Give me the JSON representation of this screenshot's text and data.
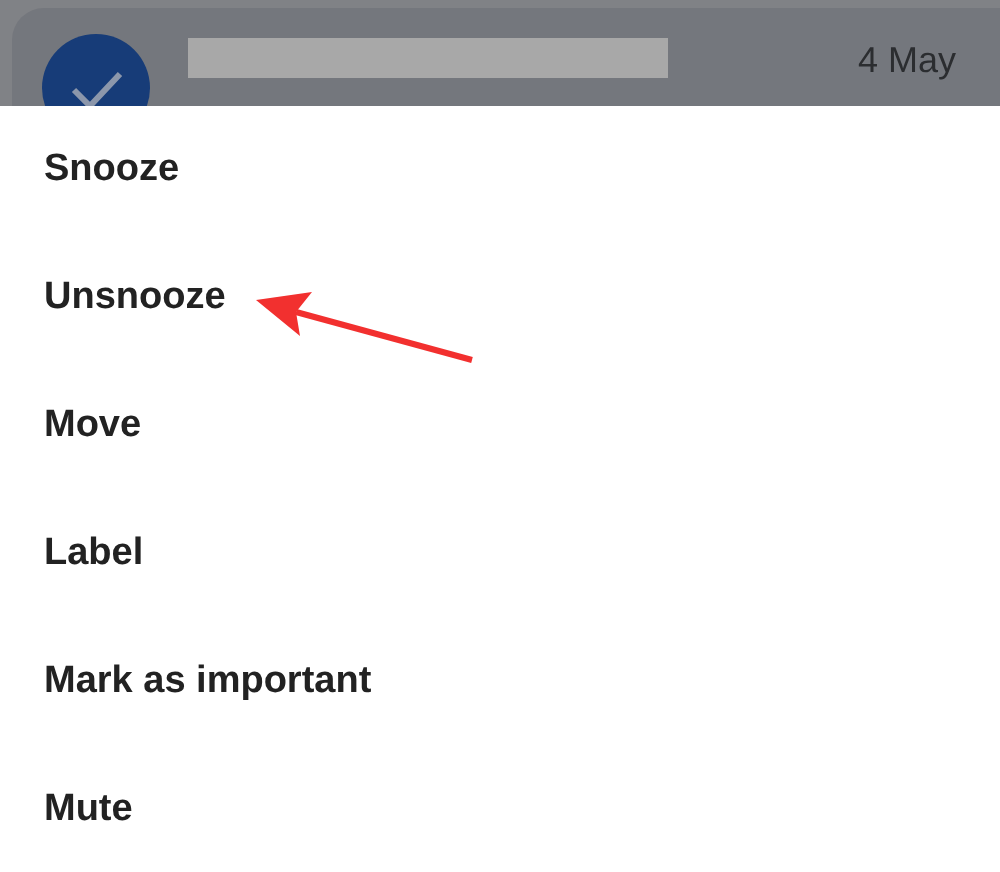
{
  "email_row": {
    "selected": true,
    "subject_redacted": true,
    "date": "4 May"
  },
  "menu": [
    {
      "label": "Snooze",
      "highlighted": false
    },
    {
      "label": "Unsnooze",
      "highlighted": true
    },
    {
      "label": "Move",
      "highlighted": false
    },
    {
      "label": "Label",
      "highlighted": false
    },
    {
      "label": "Mark as important",
      "highlighted": false
    },
    {
      "label": "Mute",
      "highlighted": false
    }
  ]
}
